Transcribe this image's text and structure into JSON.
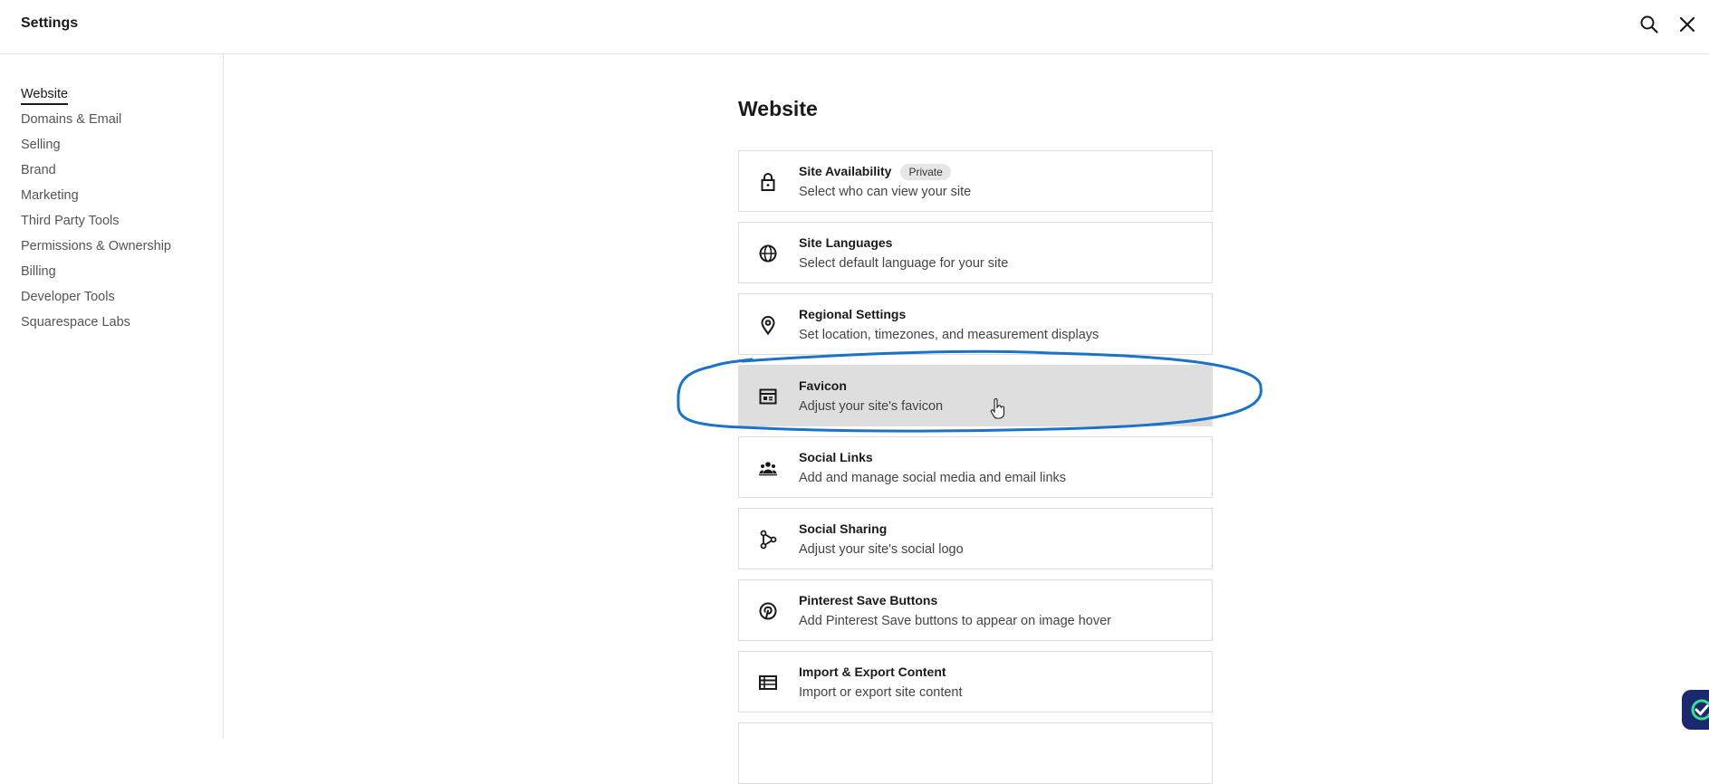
{
  "header": {
    "title": "Settings",
    "search_icon": "search-icon",
    "close_icon": "close-icon"
  },
  "sidebar": {
    "items": [
      {
        "label": "Website",
        "active": true
      },
      {
        "label": "Domains & Email"
      },
      {
        "label": "Selling"
      },
      {
        "label": "Brand"
      },
      {
        "label": "Marketing"
      },
      {
        "label": "Third Party Tools"
      },
      {
        "label": "Permissions & Ownership"
      },
      {
        "label": "Billing"
      },
      {
        "label": "Developer Tools"
      },
      {
        "label": "Squarespace Labs"
      }
    ]
  },
  "main": {
    "title": "Website",
    "cards": [
      {
        "title": "Site Availability",
        "badge": "Private",
        "description": "Select who can view your site",
        "icon": "lock-icon"
      },
      {
        "title": "Site Languages",
        "description": "Select default language for your site",
        "icon": "globe-icon"
      },
      {
        "title": "Regional Settings",
        "description": "Set location, timezones, and measurement displays",
        "icon": "location-pin-icon"
      },
      {
        "title": "Favicon",
        "description": "Adjust your site's favicon",
        "icon": "browser-window-icon",
        "highlighted": true
      },
      {
        "title": "Social Links",
        "description": "Add and manage social media and email links",
        "icon": "people-icon"
      },
      {
        "title": "Social Sharing",
        "description": "Adjust your site's social logo",
        "icon": "share-icon"
      },
      {
        "title": "Pinterest Save Buttons",
        "description": "Add Pinterest Save buttons to appear on image hover",
        "icon": "pinterest-icon"
      },
      {
        "title": "Import & Export Content",
        "description": "Import or export site content",
        "icon": "table-icon"
      }
    ]
  },
  "colors": {
    "annotation": "#1a73c8",
    "hover_bg": "#dedede",
    "widget": "#1a2a6c",
    "widget_check": "#3ddc97"
  }
}
